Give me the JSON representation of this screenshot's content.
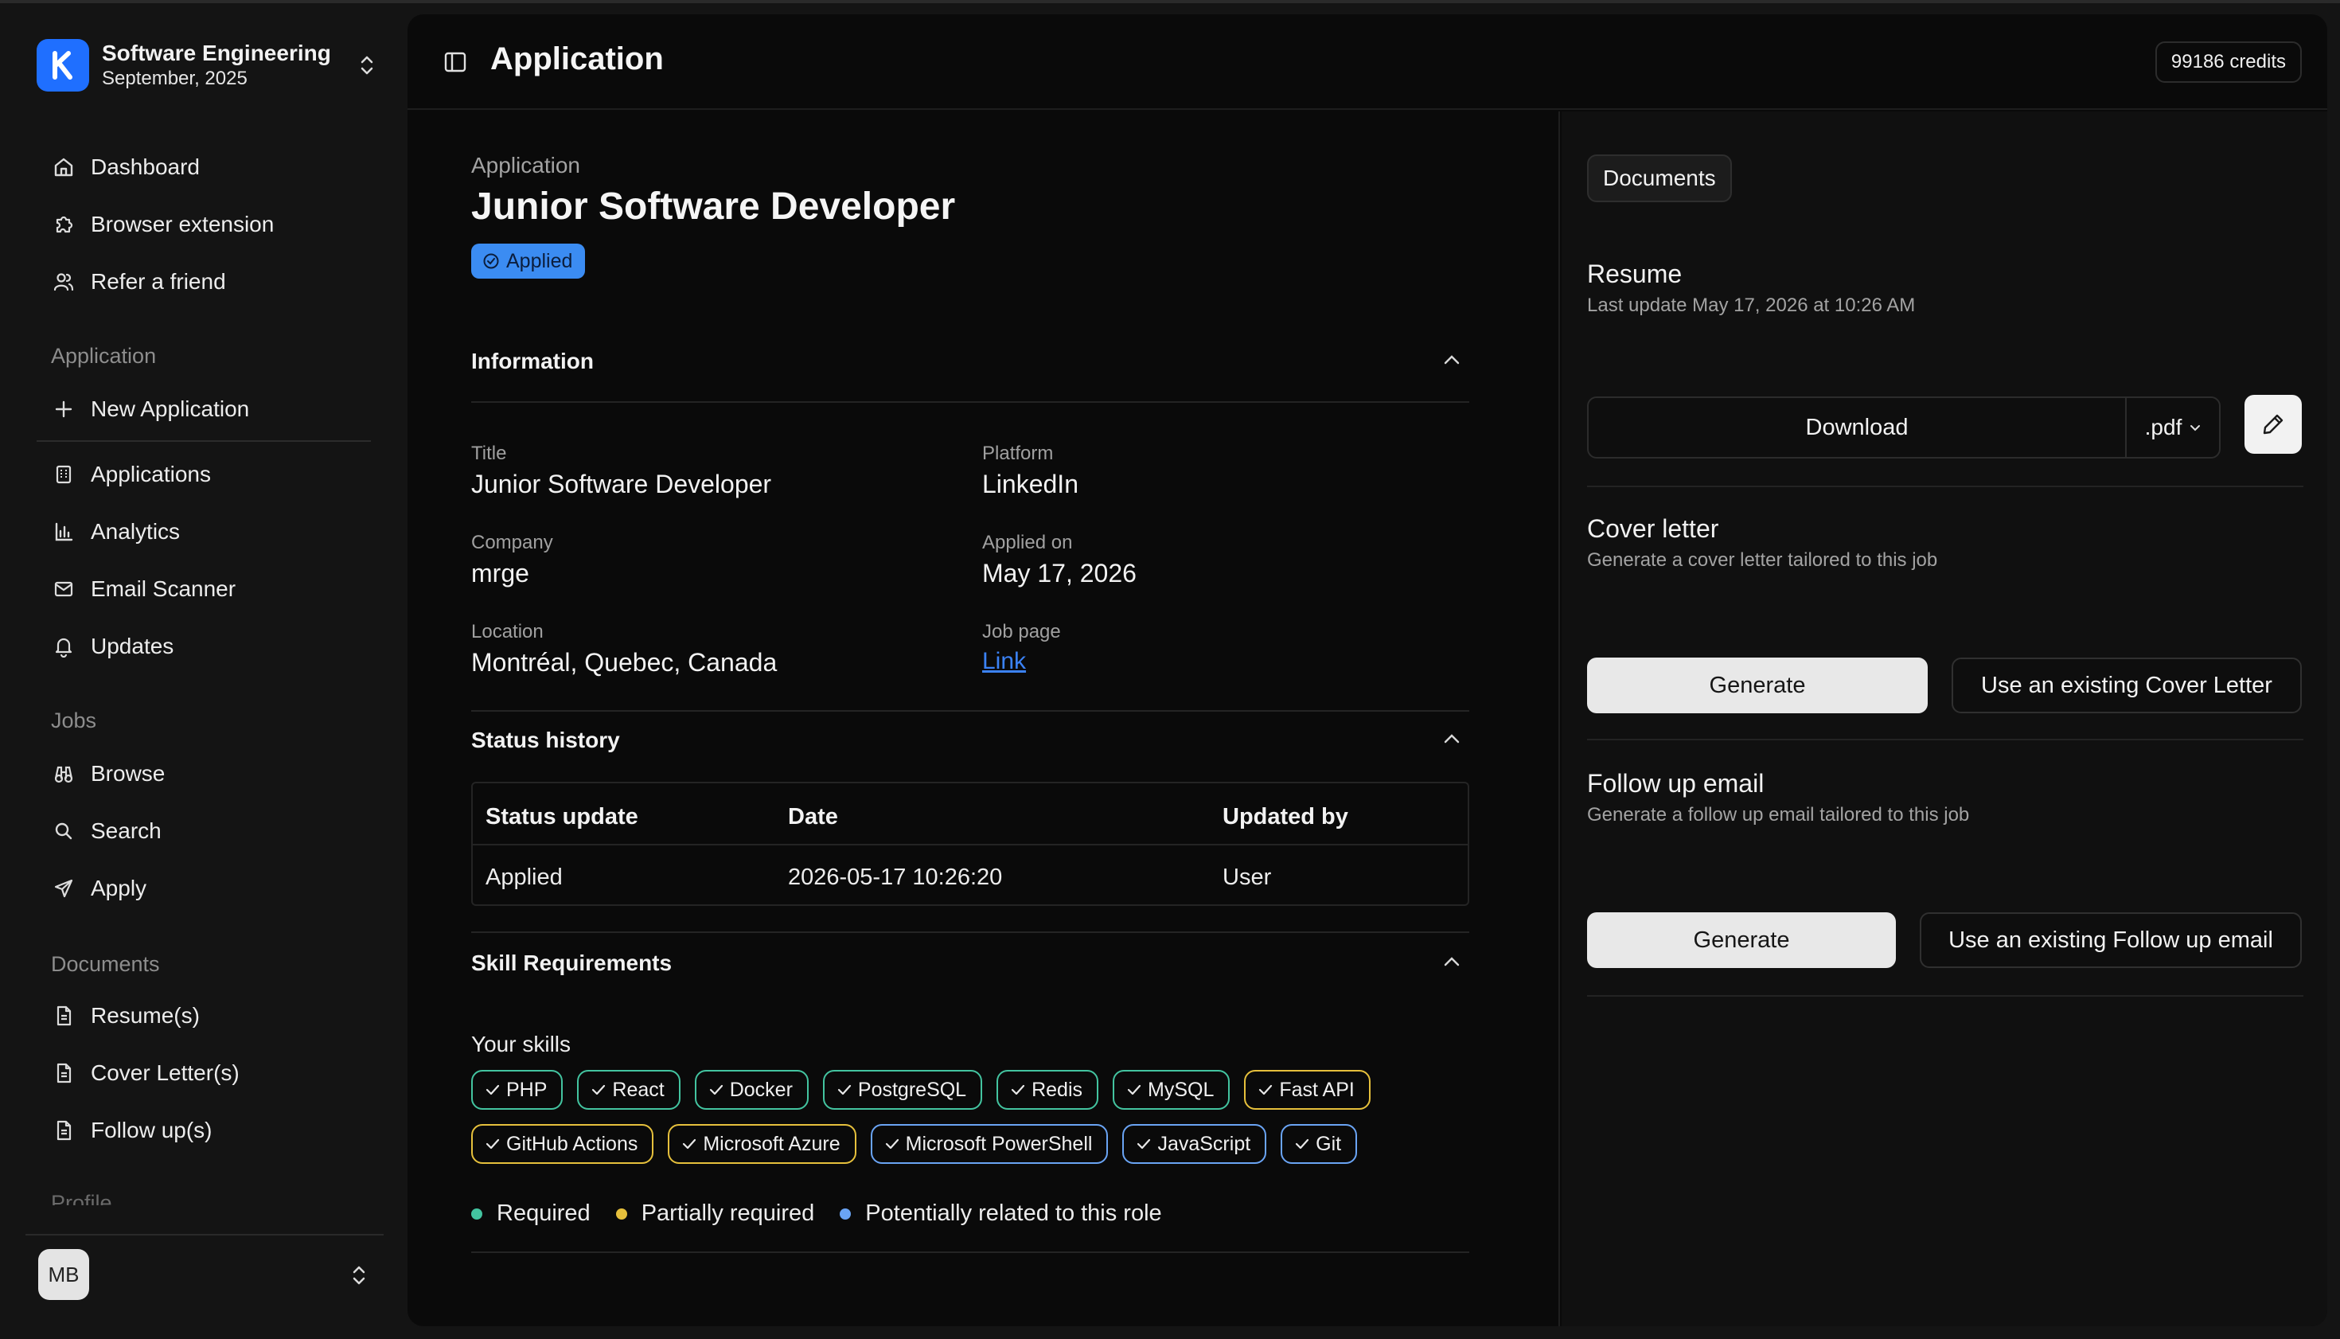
{
  "workspace": {
    "name": "Software Engineering",
    "date": "September, 2025",
    "logo_letter": "k"
  },
  "nav": {
    "top": [
      {
        "label": "Dashboard",
        "icon": "home-icon"
      },
      {
        "label": "Browser extension",
        "icon": "puzzle-icon"
      },
      {
        "label": "Refer a friend",
        "icon": "users-icon"
      }
    ],
    "application_label": "Application",
    "application": [
      {
        "label": "New Application",
        "icon": "plus-icon"
      },
      {
        "label": "Applications",
        "icon": "building-icon"
      },
      {
        "label": "Analytics",
        "icon": "bar-chart-icon"
      },
      {
        "label": "Email Scanner",
        "icon": "mail-icon"
      },
      {
        "label": "Updates",
        "icon": "bell-icon"
      }
    ],
    "jobs_label": "Jobs",
    "jobs": [
      {
        "label": "Browse",
        "icon": "binoculars-icon"
      },
      {
        "label": "Search",
        "icon": "search-icon"
      },
      {
        "label": "Apply",
        "icon": "send-icon"
      }
    ],
    "documents_label": "Documents",
    "documents": [
      {
        "label": "Resume(s)",
        "icon": "file-icon"
      },
      {
        "label": "Cover Letter(s)",
        "icon": "file-icon"
      },
      {
        "label": "Follow up(s)",
        "icon": "file-icon"
      }
    ],
    "profile_label": "Profile"
  },
  "user": {
    "initials": "MB"
  },
  "header": {
    "title": "Application",
    "credits": "99186 credits"
  },
  "application": {
    "breadcrumb": "Application",
    "title": "Junior Software Developer",
    "status": "Applied"
  },
  "information": {
    "title": "Information",
    "fields": {
      "title_label": "Title",
      "title_value": "Junior Software Developer",
      "platform_label": "Platform",
      "platform_value": "LinkedIn",
      "company_label": "Company",
      "company_value": "mrge",
      "applied_label": "Applied on",
      "applied_value": "May 17, 2026",
      "location_label": "Location",
      "location_value": "Montréal, Quebec, Canada",
      "jobpage_label": "Job page",
      "jobpage_value": "Link"
    }
  },
  "status_history": {
    "title": "Status history",
    "columns": [
      "Status update",
      "Date",
      "Updated by"
    ],
    "rows": [
      {
        "status": "Applied",
        "date": "2026-05-17 10:26:20",
        "by": "User"
      }
    ]
  },
  "skills": {
    "title": "Skill Requirements",
    "your_skills_label": "Your skills",
    "row1": [
      {
        "name": "PHP",
        "level": "required"
      },
      {
        "name": "React",
        "level": "required"
      },
      {
        "name": "Docker",
        "level": "required"
      },
      {
        "name": "PostgreSQL",
        "level": "required"
      },
      {
        "name": "Redis",
        "level": "required"
      },
      {
        "name": "MySQL",
        "level": "required"
      },
      {
        "name": "Fast API",
        "level": "partial"
      }
    ],
    "row2": [
      {
        "name": "GitHub Actions",
        "level": "partial"
      },
      {
        "name": "Microsoft Azure",
        "level": "partial"
      },
      {
        "name": "Microsoft PowerShell",
        "level": "potential"
      },
      {
        "name": "JavaScript",
        "level": "potential"
      },
      {
        "name": "Git",
        "level": "potential"
      }
    ],
    "legend": {
      "required": "Required",
      "partial": "Partially required",
      "potential": "Potentially related to this role"
    },
    "colors": {
      "required": "#43c4a0",
      "partial": "#e6c03c",
      "potential": "#6aa4f4"
    }
  },
  "documents": {
    "tab": "Documents",
    "resume": {
      "title": "Resume",
      "subtitle": "Last update May 17, 2026 at 10:26 AM",
      "download": "Download",
      "format": ".pdf"
    },
    "cover_letter": {
      "title": "Cover letter",
      "subtitle": "Generate a cover letter tailored to this job",
      "generate": "Generate",
      "existing": "Use an existing Cover Letter"
    },
    "follow_up": {
      "title": "Follow up email",
      "subtitle": "Generate a follow up email tailored to this job",
      "generate": "Generate",
      "existing": "Use an existing Follow up email"
    }
  }
}
